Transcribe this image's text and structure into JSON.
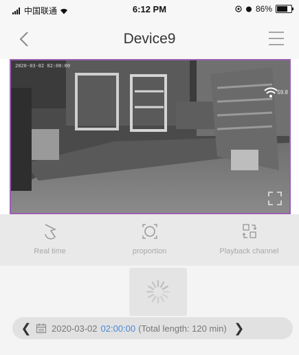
{
  "status_bar": {
    "carrier": "中国联通",
    "time": "6:12 PM",
    "battery": "86%",
    "battery_level": 0.86
  },
  "nav": {
    "title": "Device9",
    "back_icon": "chevron-left-icon",
    "menu_icon": "hamburger-menu-icon"
  },
  "video": {
    "accent_color": "#9a5fb3",
    "timestamp": "2020-03-02 02:00:00",
    "wifi_label": "59.8"
  },
  "controls": [
    {
      "label": "Real time",
      "icon": "real-time-icon"
    },
    {
      "label": "proportion",
      "icon": "proportion-icon"
    },
    {
      "label": "Playback channel",
      "icon": "playback-channel-icon"
    }
  ],
  "playback": {
    "date": "2020-03-02",
    "time": "02:00:00",
    "length": "(Total length: 120 min)",
    "time_color": "#4a88d8"
  }
}
